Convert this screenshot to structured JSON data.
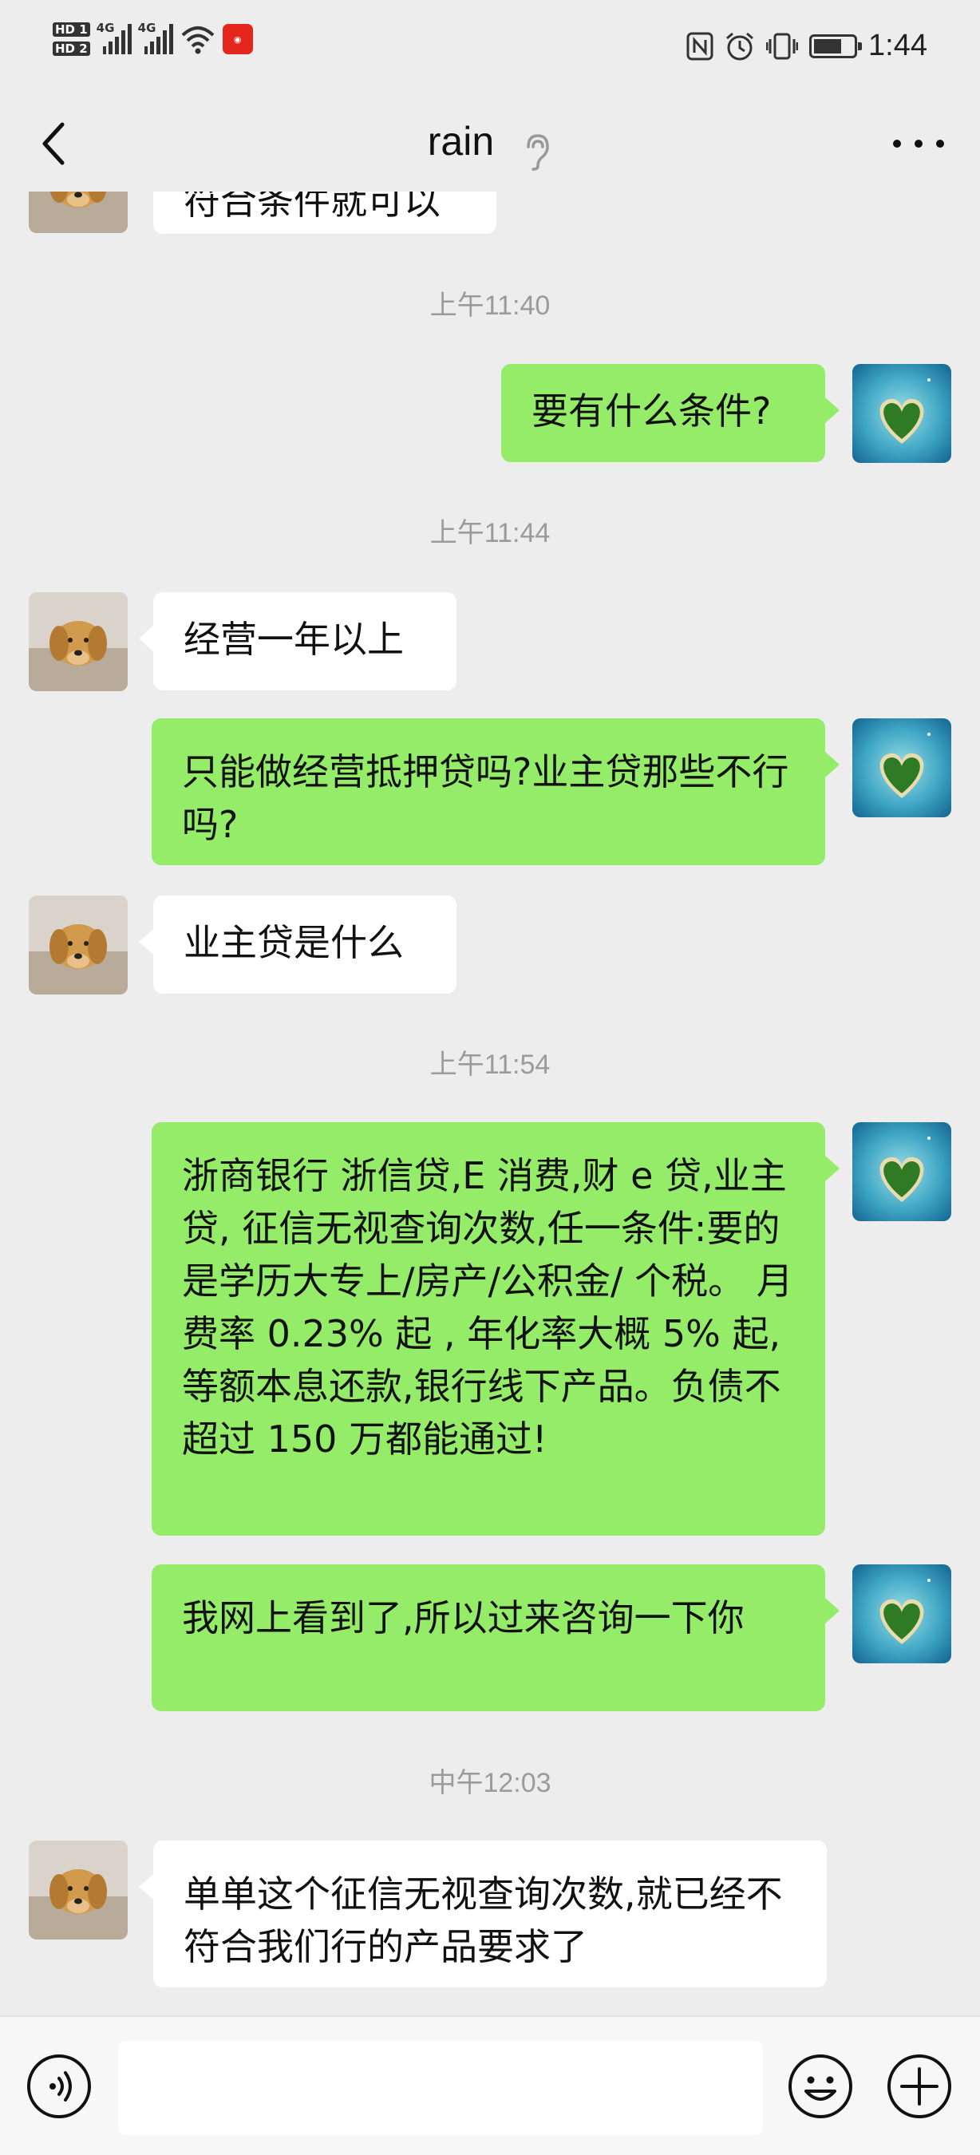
{
  "status_bar": {
    "time": "1:44",
    "sim1": "HD 1",
    "sim2": "HD 2",
    "network1": "4G",
    "network2": "4G",
    "icons": [
      "nfc-icon",
      "alarm-icon",
      "vibrate-icon",
      "battery-icon"
    ]
  },
  "header": {
    "title": "rain",
    "back_icon": "chevron-left-icon",
    "earpiece_icon": "earpiece-mode-icon",
    "more_icon": "more-dots-icon"
  },
  "messages": [
    {
      "type": "partial",
      "side": "left",
      "text": "符合条件就可以"
    },
    {
      "type": "time",
      "text": "上午11:40"
    },
    {
      "type": "msg",
      "side": "right",
      "text": "要有什么条件?"
    },
    {
      "type": "time",
      "text": "上午11:44"
    },
    {
      "type": "msg",
      "side": "left",
      "text": "经营一年以上"
    },
    {
      "type": "msg",
      "side": "right",
      "text": "只能做经营抵押贷吗?业主贷那些不行吗?"
    },
    {
      "type": "msg",
      "side": "left",
      "text": "业主贷是什么"
    },
    {
      "type": "time",
      "text": "上午11:54"
    },
    {
      "type": "msg",
      "side": "right",
      "text": "浙商银行 浙信贷,E 消费,财 e 贷,业主贷, 征信无视查询次数,任一条件:要的是学历大专上/房产/公积金/ 个税。 月费率 0.23% 起 , 年化率大概 5% 起,等额本息还款,银行线下产品。负债不超过 150 万都能通过!"
    },
    {
      "type": "msg",
      "side": "right",
      "text": "我网上看到了,所以过来咨询一下你"
    },
    {
      "type": "time",
      "text": "中午12:03"
    },
    {
      "type": "msg",
      "side": "left",
      "text": "单单这个征信无视查询次数,就已经不符合我们行的产品要求了"
    }
  ],
  "input_bar": {
    "voice_icon": "voice-input-icon",
    "placeholder": "",
    "emoji_icon": "emoji-icon",
    "plus_icon": "plus-icon"
  },
  "colors": {
    "background": "#ededed",
    "bubble_self": "#95ec69",
    "bubble_other": "#ffffff",
    "timestamp": "#9b9b9b"
  }
}
